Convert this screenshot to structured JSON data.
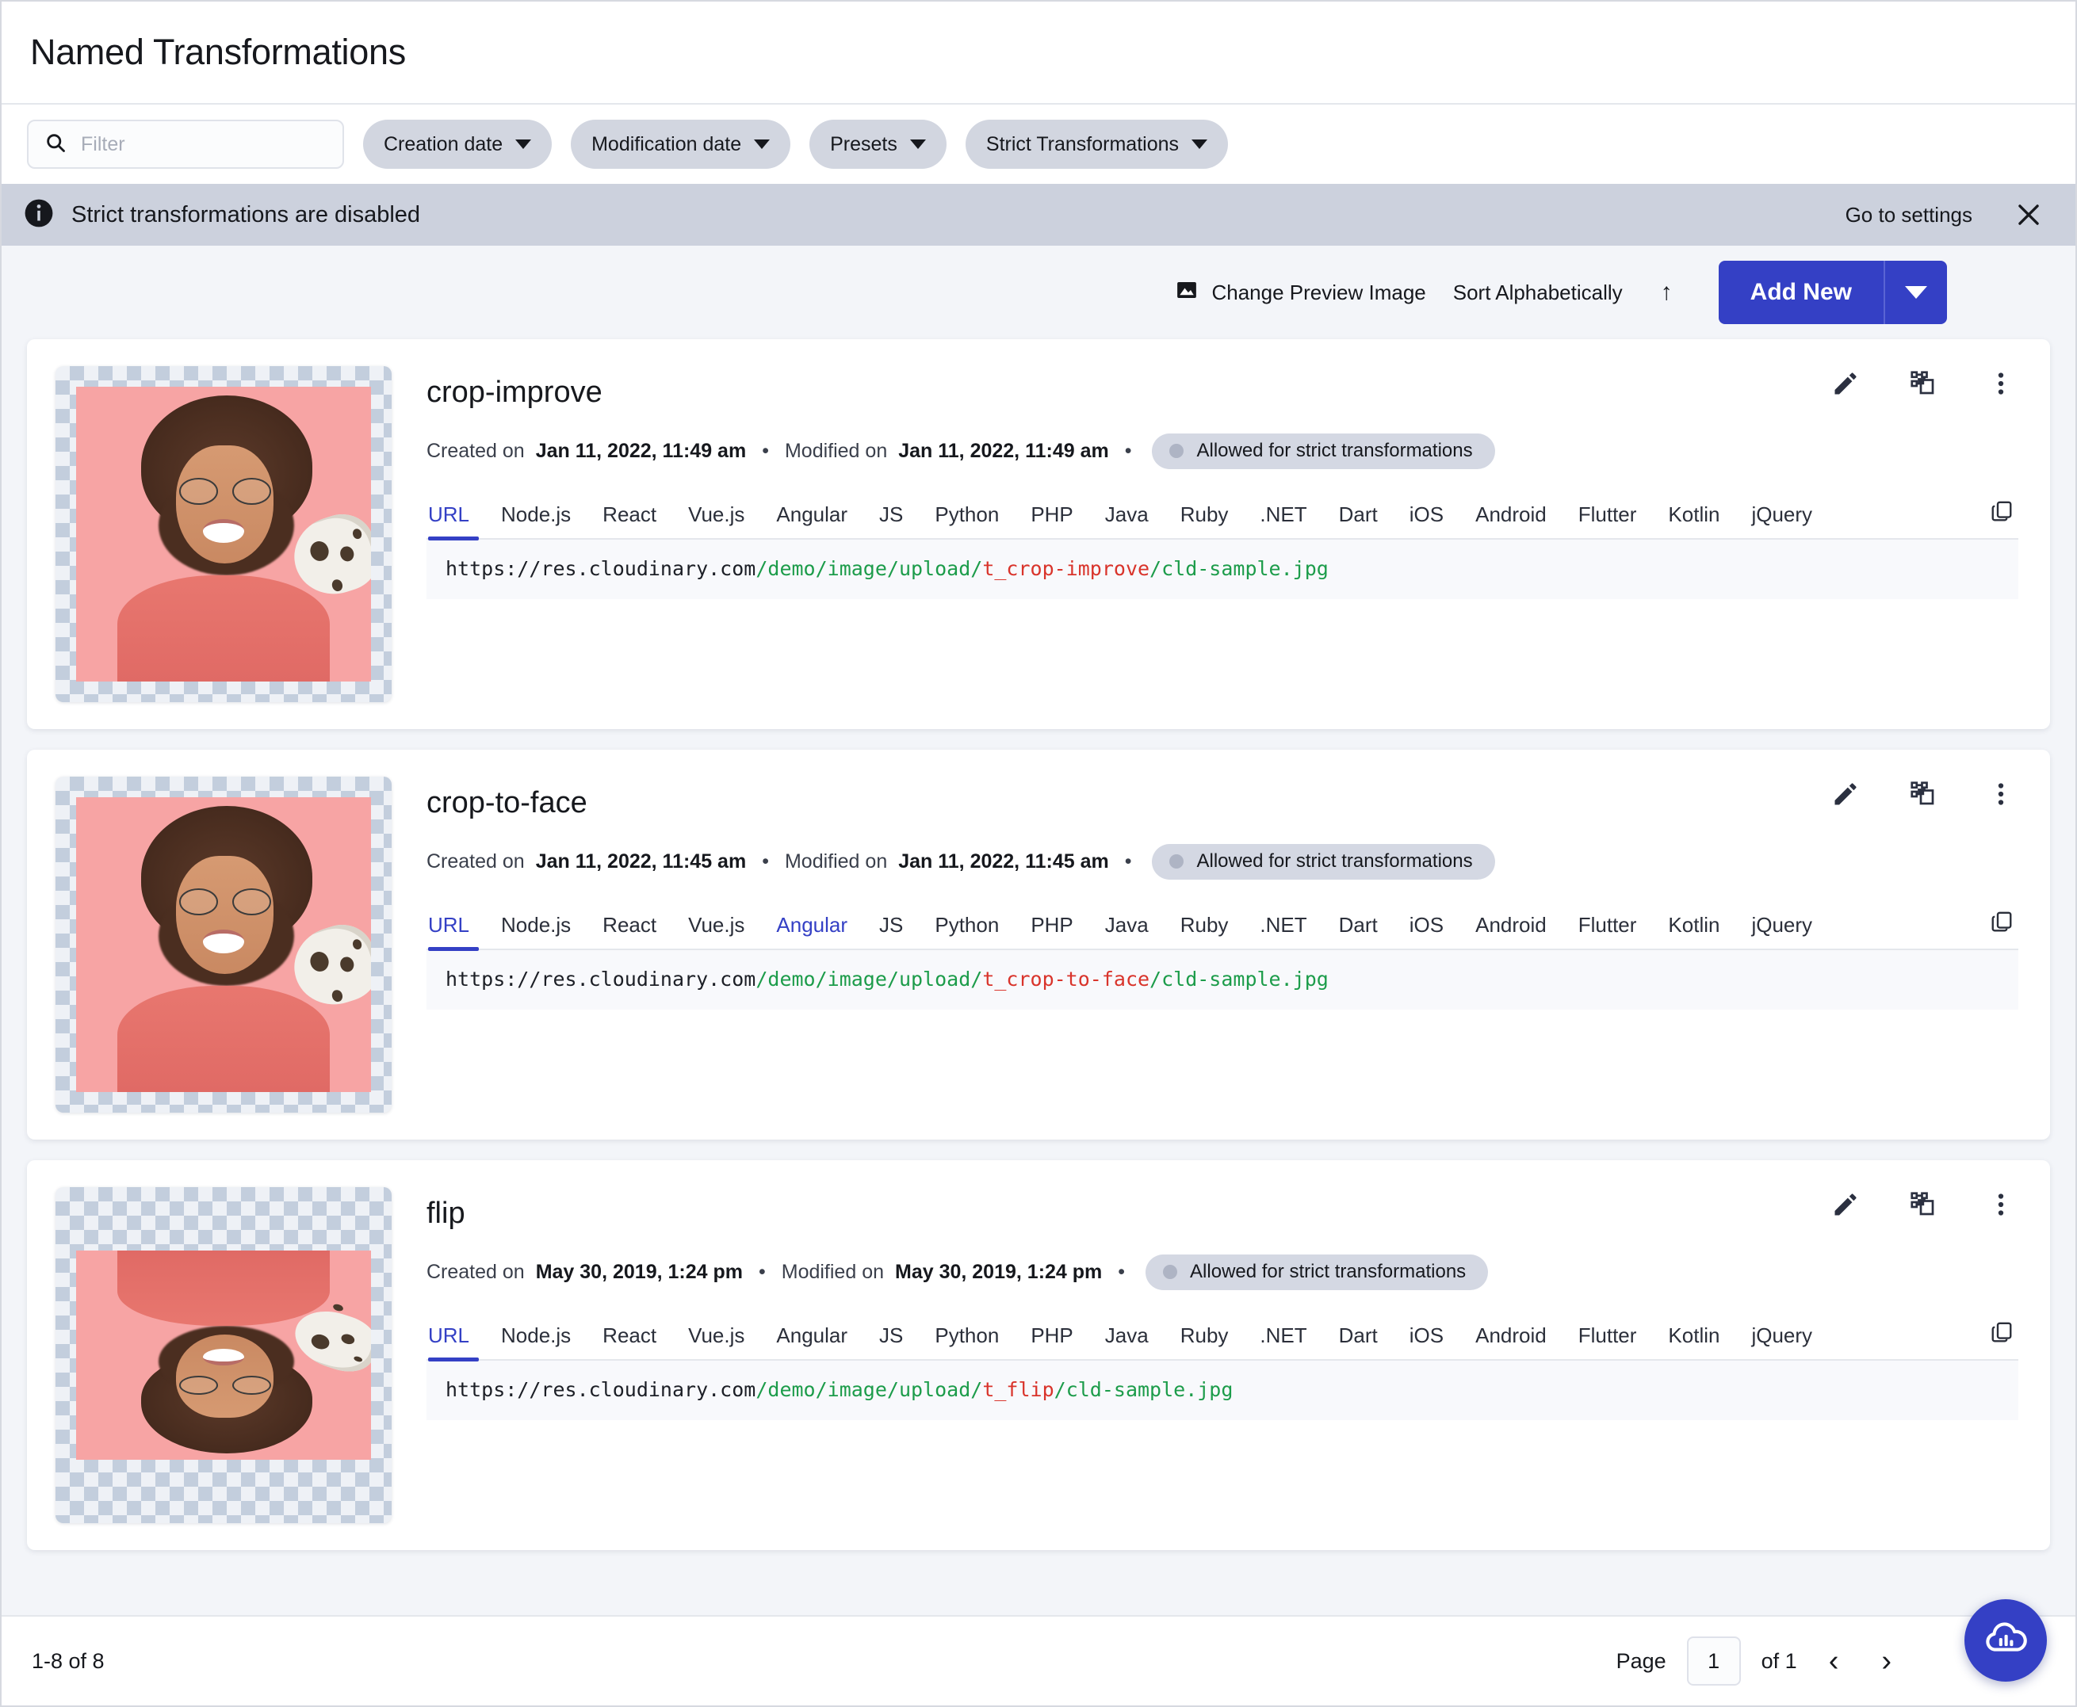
{
  "header": {
    "title": "Named Transformations"
  },
  "filter_bar": {
    "search_placeholder": "Filter",
    "search_value": "",
    "chips": [
      {
        "label": "Creation date"
      },
      {
        "label": "Modification date"
      },
      {
        "label": "Presets"
      },
      {
        "label": "Strict Transformations"
      }
    ]
  },
  "banner": {
    "message": "Strict transformations are disabled",
    "action_label": "Go to settings",
    "icon": "info-icon",
    "close_icon": "close-icon"
  },
  "toolbar": {
    "change_preview_label": "Change Preview Image",
    "change_preview_icon": "image-icon",
    "sort_label": "Sort Alphabetically",
    "sort_direction_icon": "arrow-up-icon",
    "add_new_label": "Add New",
    "add_new_caret_icon": "chevron-down-icon",
    "accent_color": "#3440c5"
  },
  "tabs": [
    "URL",
    "Node.js",
    "React",
    "Vue.js",
    "Angular",
    "JS",
    "Python",
    "PHP",
    "Java",
    "Ruby",
    ".NET",
    "Dart",
    "iOS",
    "Android",
    "Flutter",
    "Kotlin",
    "jQuery"
  ],
  "labels": {
    "created_on": "Created on",
    "modified_on": "Modified on",
    "separator": "•",
    "badge_allowed": "Allowed for strict transformations",
    "copy_icon": "copy-icon",
    "edit_icon": "pencil-icon",
    "graph_icon": "transformation-nodes-icon",
    "menu_icon": "more-vertical-icon"
  },
  "cards": [
    {
      "name": "crop-improve",
      "created_on": "Jan 11, 2022, 11:49 am",
      "modified_on": "Jan 11, 2022, 11:49 am",
      "badge": "Allowed for strict transformations",
      "active_tab": "URL",
      "hover_tab": "",
      "thumb_shape": "square",
      "flipped": false,
      "url": {
        "host": "https://res.cloudinary.com",
        "path": "/demo/image/upload/",
        "transformation": "t_crop-improve",
        "asset": "/cld-sample.jpg"
      }
    },
    {
      "name": "crop-to-face",
      "created_on": "Jan 11, 2022, 11:45 am",
      "modified_on": "Jan 11, 2022, 11:45 am",
      "badge": "Allowed for strict transformations",
      "active_tab": "URL",
      "hover_tab": "Angular",
      "thumb_shape": "square",
      "flipped": false,
      "url": {
        "host": "https://res.cloudinary.com",
        "path": "/demo/image/upload/",
        "transformation": "t_crop-to-face",
        "asset": "/cld-sample.jpg"
      }
    },
    {
      "name": "flip",
      "created_on": "May 30, 2019, 1:24 pm",
      "modified_on": "May 30, 2019, 1:24 pm",
      "badge": "Allowed for strict transformations",
      "active_tab": "URL",
      "hover_tab": "",
      "thumb_shape": "wide",
      "flipped": true,
      "url": {
        "host": "https://res.cloudinary.com",
        "path": "/demo/image/upload/",
        "transformation": "t_flip",
        "asset": "/cld-sample.jpg"
      }
    }
  ],
  "footer": {
    "range_text": "1-8 of 8",
    "page_label": "Page",
    "page_value": "1",
    "of_label": "of 1",
    "prev_icon": "chevron-left-icon",
    "next_icon": "chevron-right-icon",
    "fab_icon": "cloudinary-cloud-icon"
  }
}
